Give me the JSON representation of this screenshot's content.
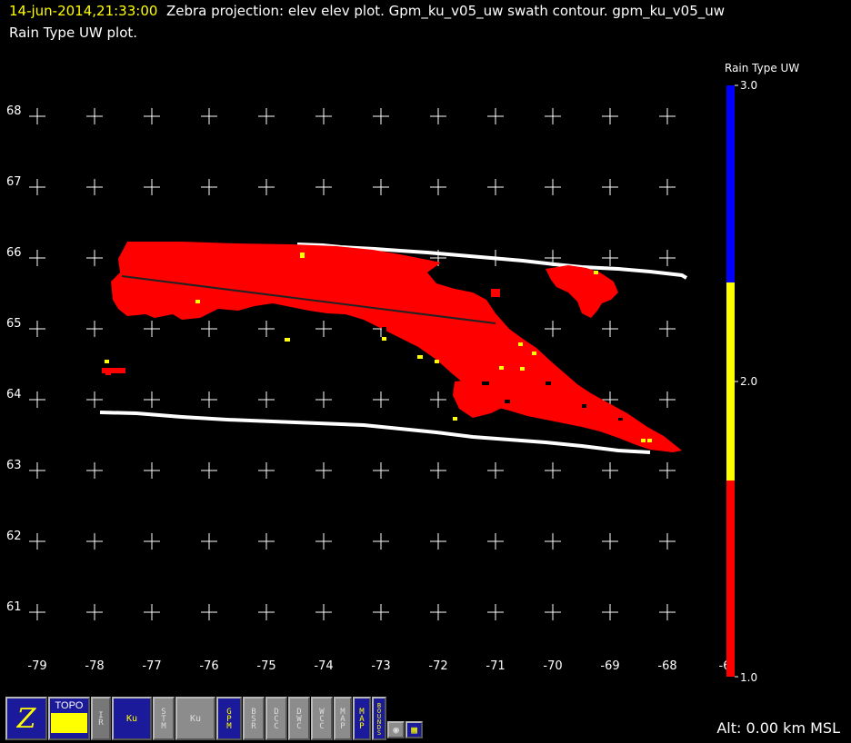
{
  "header": {
    "timestamp": "14-jun-2014,21:33:00",
    "title_rest": "Zebra projection: elev elev  plot.  Gpm_ku_v05_uw swath contour.  gpm_ku_v05_uw",
    "title_line2": "Rain Type UW  plot."
  },
  "map": {
    "y_labels": [
      "68",
      "67",
      "66",
      "65",
      "64",
      "63",
      "62",
      "61"
    ],
    "x_labels": [
      "-79",
      "-78",
      "-77",
      "-76",
      "-75",
      "-74",
      "-73",
      "-72",
      "-71",
      "-70",
      "-69",
      "-68",
      "-6"
    ]
  },
  "colorbar": {
    "title": "Rain Type UW",
    "top_label": "3.0",
    "mid_label": "2.0",
    "bottom_label": "1.0",
    "colors": {
      "high": "#0000ff",
      "mid": "#ffff00",
      "low": "#ff0000"
    }
  },
  "status": {
    "altitude": "Alt: 0.00 km MSL"
  },
  "toolbar": {
    "buttons": [
      {
        "label": "Z",
        "icon": "zebra-logo-icon"
      },
      {
        "label": "TOPO",
        "icon": "topo-icon"
      },
      {
        "label": "IR",
        "icon": "satellite-ir-icon"
      },
      {
        "label": "Ku",
        "icon": "gpm-ku-icon"
      },
      {
        "label": "STM",
        "icon": ""
      },
      {
        "label": "Ku",
        "icon": "gpm-ku-v5-icon"
      },
      {
        "label": "GPM",
        "icon": "gpm-csf-icon"
      },
      {
        "label": "BSR",
        "icon": ""
      },
      {
        "label": "DCC",
        "icon": ""
      },
      {
        "label": "DWC",
        "icon": ""
      },
      {
        "label": "WCC",
        "icon": ""
      },
      {
        "label": "MAP",
        "icon": "map-icon"
      },
      {
        "label": "MAP",
        "icon": "map-yellow-icon"
      },
      {
        "label": "BOUNDS",
        "icon": ""
      }
    ]
  },
  "colors": {
    "rain_stratiform": "#ff0000",
    "rain_convective": "#ffff00",
    "swath_edge": "#ffffff",
    "background": "#000000"
  }
}
